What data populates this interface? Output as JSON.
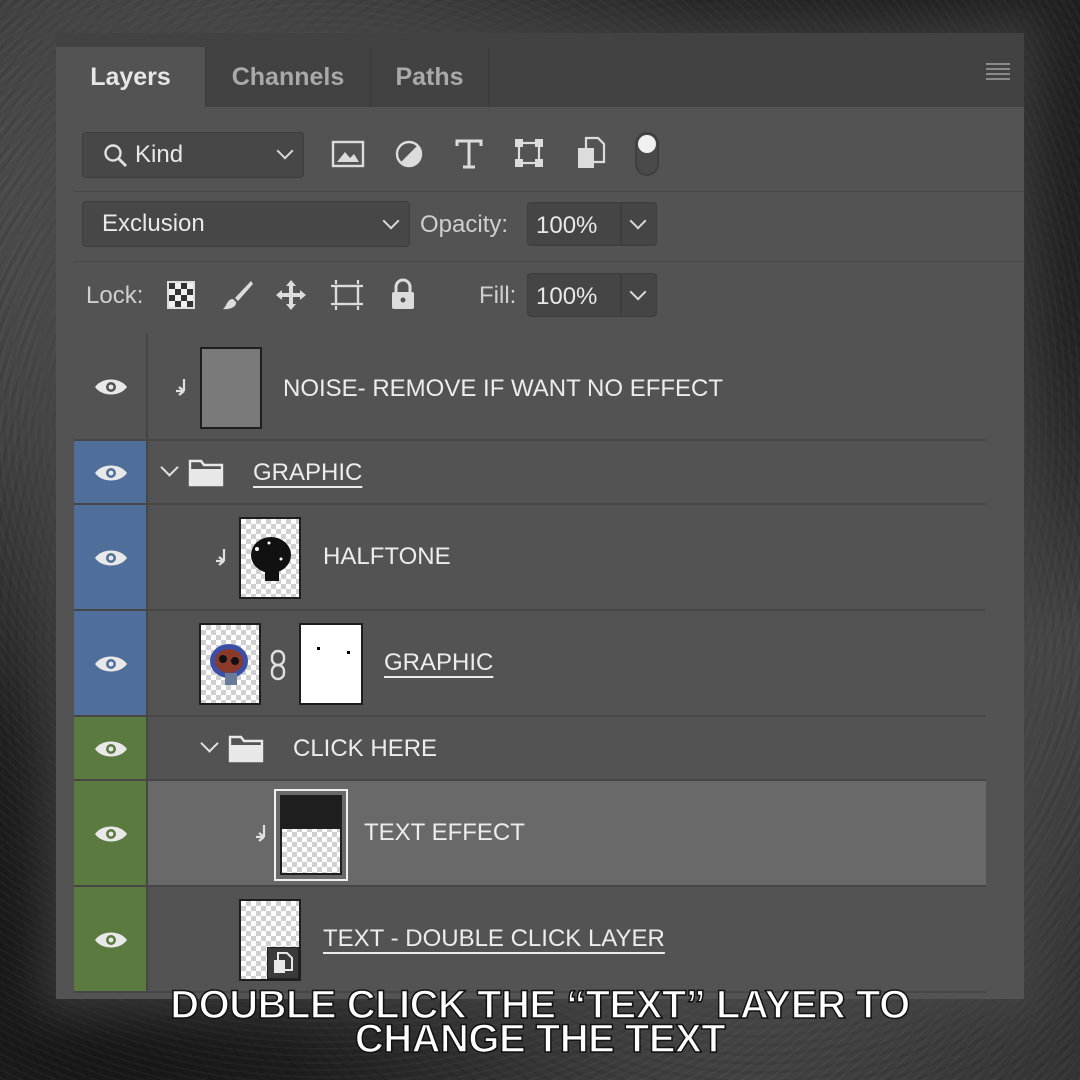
{
  "tabs": [
    {
      "label": "Layers",
      "active": true
    },
    {
      "label": "Channels",
      "active": false
    },
    {
      "label": "Paths",
      "active": false
    }
  ],
  "filter": {
    "kind_label": "Kind",
    "icons": [
      "image-filter-icon",
      "adjustment-filter-icon",
      "type-filter-icon",
      "shape-filter-icon",
      "smart-object-filter-icon"
    ],
    "toggle_on": true
  },
  "blend": {
    "mode": "Exclusion",
    "opacity_label": "Opacity:",
    "opacity_value": "100%"
  },
  "lock": {
    "label": "Lock:",
    "icons": [
      "lock-transparent-pixels-icon",
      "lock-image-pixels-icon",
      "lock-position-icon",
      "lock-artboard-icon",
      "lock-all-icon"
    ],
    "fill_label": "Fill:",
    "fill_value": "100%"
  },
  "layers": [
    {
      "name": "NOISE- REMOVE IF WANT NO EFFECT",
      "type": "clipped",
      "color": "none"
    },
    {
      "name": "GRAPHIC",
      "type": "group",
      "color": "blue"
    },
    {
      "name": "HALFTONE",
      "type": "clipped",
      "color": "blue"
    },
    {
      "name": "GRAPHIC",
      "type": "masked",
      "color": "blue"
    },
    {
      "name": "CLICK HERE",
      "type": "group",
      "color": "green"
    },
    {
      "name": "TEXT EFFECT",
      "type": "clipped",
      "color": "green",
      "selected": true
    },
    {
      "name": "TEXT - DOUBLE CLICK LAYER ",
      "type": "smart-object",
      "color": "green"
    }
  ],
  "caption": {
    "line1": "DOUBLE CLICK THE “TEXT” LAYER TO",
    "line2": "CHANGE THE TEXT"
  },
  "colors": {
    "panel": "#535353",
    "selected_row": "#696969",
    "blue_label": "#4f6f9a",
    "green_label": "#5a7a3f"
  }
}
